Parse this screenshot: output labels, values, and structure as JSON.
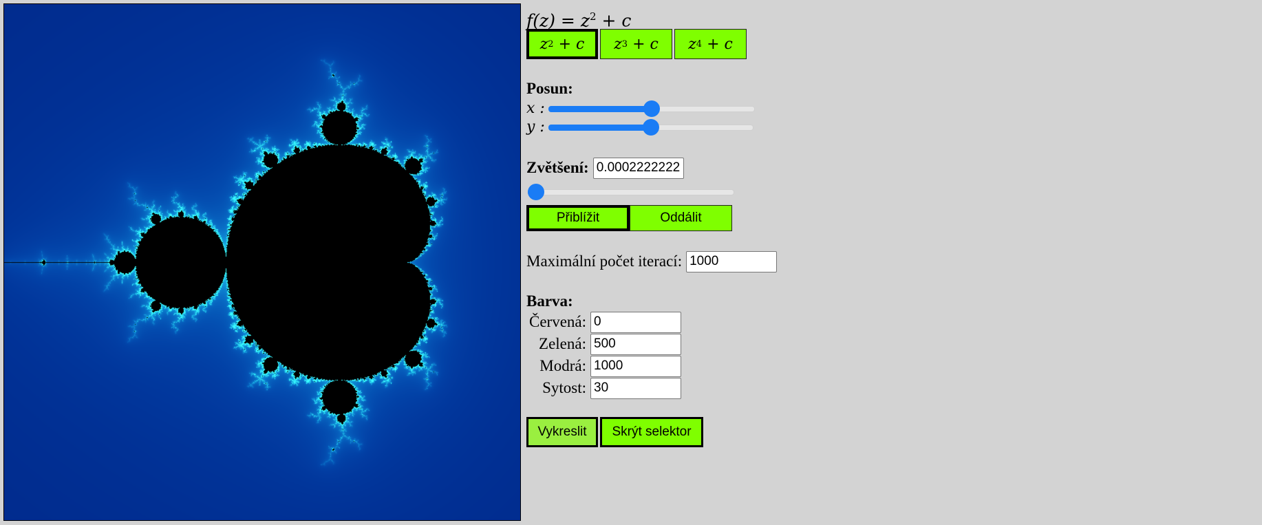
{
  "formula": {
    "f": "f",
    "arg": "z",
    "base": "z",
    "exp": "2",
    "tail": "+ c"
  },
  "functions": [
    {
      "base": "z",
      "exp": "2",
      "tail": "+ c",
      "active": true
    },
    {
      "base": "z",
      "exp": "3",
      "tail": "+ c",
      "active": false
    },
    {
      "base": "z",
      "exp": "4",
      "tail": "+ c",
      "active": false
    }
  ],
  "posun": {
    "label": "Posun:",
    "x": {
      "label": "x :",
      "value": 0.5
    },
    "y": {
      "label": "y :",
      "value": 0.5
    }
  },
  "zoom": {
    "label": "Zvětšení:",
    "value": "0.0002222222",
    "slider_value": 0.0,
    "zoom_in": "Přiblížit",
    "zoom_out": "Oddálit"
  },
  "iterations": {
    "label": "Maximální počet iterací:",
    "value": "1000"
  },
  "color": {
    "label": "Barva:",
    "red": {
      "label": "Červená:",
      "value": "0"
    },
    "green": {
      "label": "Zelená:",
      "value": "500"
    },
    "blue": {
      "label": "Modrá:",
      "value": "1000"
    },
    "saturation": {
      "label": "Sytost:",
      "value": "30"
    }
  },
  "actions": {
    "draw": "Vykreslit",
    "hide_selector": "Skrýt selektor"
  },
  "colors": {
    "accent_green": "#7fff00",
    "slider_blue": "#1a7cf5",
    "panel_bg": "#d3d3d3"
  }
}
